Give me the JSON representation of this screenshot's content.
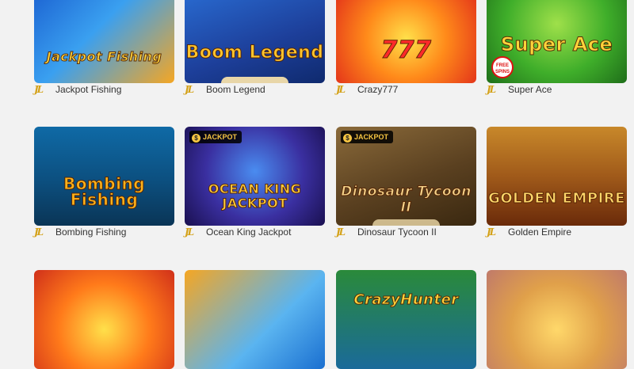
{
  "colors": {
    "page_bg": "#f2f2f2",
    "label_text": "#333333",
    "provider_gold": "#d4a21a"
  },
  "provider_logo": "JL",
  "games": [
    {
      "name": "Jackpot Fishing",
      "art_title": "Jackpot Fishing",
      "badge": ""
    },
    {
      "name": "Boom Legend",
      "art_title": "Boom Legend",
      "badge": ""
    },
    {
      "name": "Crazy777",
      "art_title": "777",
      "badge": ""
    },
    {
      "name": "Super Ace",
      "art_title": "Super Ace",
      "badge": "",
      "free_spins": "FREE SPINS"
    },
    {
      "name": "Bombing Fishing",
      "art_title": "Bombing Fishing",
      "badge": ""
    },
    {
      "name": "Ocean King Jackpot",
      "art_title": "OCEAN KING JACKPOT",
      "badge": "JACKPOT"
    },
    {
      "name": "Dinosaur Tycoon II",
      "art_title": "Dinosaur Tycoon II",
      "badge": "JACKPOT"
    },
    {
      "name": "Golden Empire",
      "art_title": "GOLDEN EMPIRE",
      "badge": ""
    },
    {
      "name": "",
      "art_title": "",
      "badge": ""
    },
    {
      "name": "",
      "art_title": "",
      "badge": ""
    },
    {
      "name": "",
      "art_title": "CrazyHunter",
      "badge": ""
    },
    {
      "name": "",
      "art_title": "",
      "badge": ""
    }
  ]
}
